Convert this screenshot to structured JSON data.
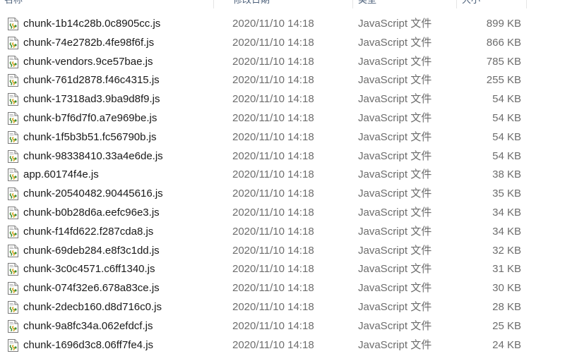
{
  "header": {
    "name": "名称",
    "date": "修改日期",
    "type": "类型",
    "size": "大小"
  },
  "icons": {
    "file": "js-script-file-icon"
  },
  "colors": {
    "hover_row": "#e5f3ff",
    "secondary_text": "#6d6d6d"
  },
  "files": [
    {
      "name": "chunk-1b14c28b.0c8905cc.js",
      "date": "2020/11/10 14:18",
      "type": "JavaScript 文件",
      "size": "899 KB"
    },
    {
      "name": "chunk-74e2782b.4fe98f6f.js",
      "date": "2020/11/10 14:18",
      "type": "JavaScript 文件",
      "size": "866 KB"
    },
    {
      "name": "chunk-vendors.9ce57bae.js",
      "date": "2020/11/10 14:18",
      "type": "JavaScript 文件",
      "size": "785 KB"
    },
    {
      "name": "chunk-761d2878.f46c4315.js",
      "date": "2020/11/10 14:18",
      "type": "JavaScript 文件",
      "size": "255 KB"
    },
    {
      "name": "chunk-17318ad3.9ba9d8f9.js",
      "date": "2020/11/10 14:18",
      "type": "JavaScript 文件",
      "size": "54 KB"
    },
    {
      "name": "chunk-b7f6d7f0.a7e969be.js",
      "date": "2020/11/10 14:18",
      "type": "JavaScript 文件",
      "size": "54 KB"
    },
    {
      "name": "chunk-1f5b3b51.fc56790b.js",
      "date": "2020/11/10 14:18",
      "type": "JavaScript 文件",
      "size": "54 KB"
    },
    {
      "name": "chunk-98338410.33a4e6de.js",
      "date": "2020/11/10 14:18",
      "type": "JavaScript 文件",
      "size": "54 KB"
    },
    {
      "name": "app.60174f4e.js",
      "date": "2020/11/10 14:18",
      "type": "JavaScript 文件",
      "size": "38 KB"
    },
    {
      "name": "chunk-20540482.90445616.js",
      "date": "2020/11/10 14:18",
      "type": "JavaScript 文件",
      "size": "35 KB"
    },
    {
      "name": "chunk-b0b28d6a.eefc96e3.js",
      "date": "2020/11/10 14:18",
      "type": "JavaScript 文件",
      "size": "34 KB"
    },
    {
      "name": "chunk-f14fd622.f287cda8.js",
      "date": "2020/11/10 14:18",
      "type": "JavaScript 文件",
      "size": "34 KB"
    },
    {
      "name": "chunk-69deb284.e8f3c1dd.js",
      "date": "2020/11/10 14:18",
      "type": "JavaScript 文件",
      "size": "32 KB"
    },
    {
      "name": "chunk-3c0c4571.c6ff1340.js",
      "date": "2020/11/10 14:18",
      "type": "JavaScript 文件",
      "size": "31 KB"
    },
    {
      "name": "chunk-074f32e6.678a83ce.js",
      "date": "2020/11/10 14:18",
      "type": "JavaScript 文件",
      "size": "30 KB"
    },
    {
      "name": "chunk-2decb160.d8d716c0.js",
      "date": "2020/11/10 14:18",
      "type": "JavaScript 文件",
      "size": "28 KB"
    },
    {
      "name": "chunk-9a8fc34a.062efdcf.js",
      "date": "2020/11/10 14:18",
      "type": "JavaScript 文件",
      "size": "25 KB"
    },
    {
      "name": "chunk-1696d3c8.06ff7fe4.js",
      "date": "2020/11/10 14:18",
      "type": "JavaScript 文件",
      "size": "24 KB"
    }
  ]
}
